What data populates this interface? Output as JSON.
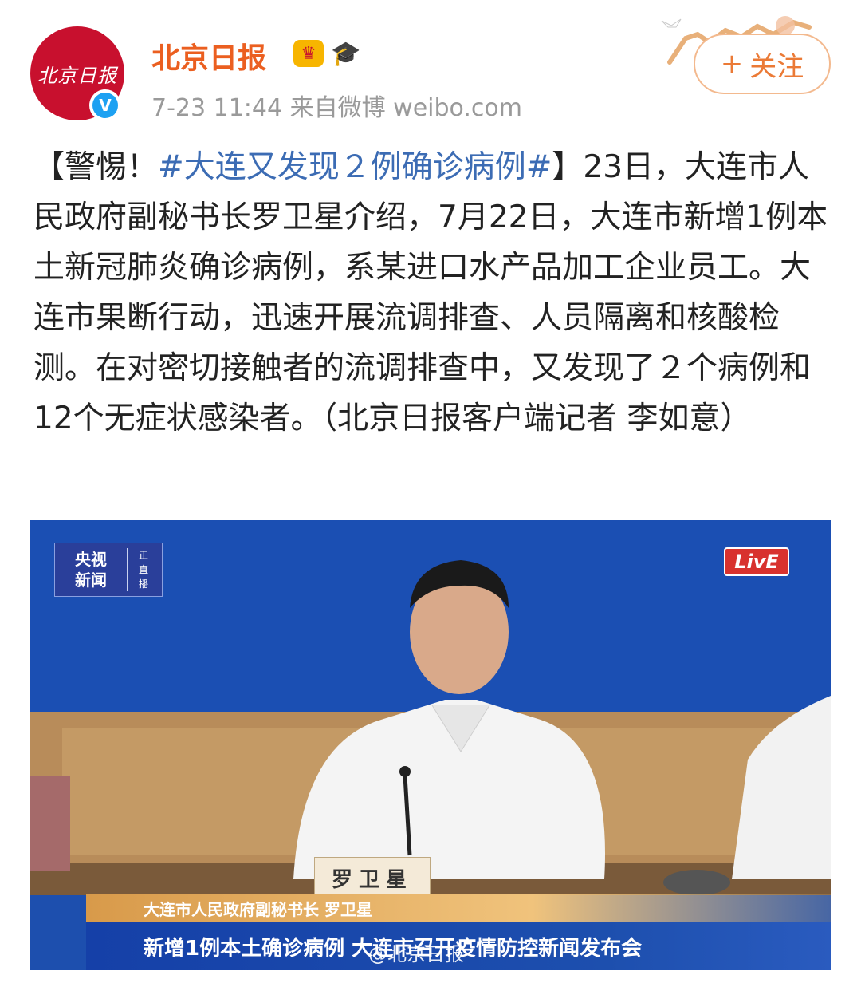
{
  "header": {
    "avatar_text": "北京日报",
    "verified_mark": "V",
    "username": "北京日报",
    "badges": [
      "crown-badge-icon",
      "graduation-cap-icon"
    ],
    "timestamp": "7-23 11:44",
    "source": "来自微博 weibo.com",
    "follow_label": "关注",
    "follow_plus": "+"
  },
  "post": {
    "prefix": "【警惕！",
    "hashtag": "#大连又发现２例确诊病例#",
    "body": "】23日，大连市人民政府副秘书长罗卫星介绍，7月22日，大连市新增1例本土新冠肺炎确诊病例，系某进口水产品加工企业员工。大连市果断行动，迅速开展流调排查、人员隔离和核酸检测。在对密切接触者的流调排查中，又发现了２个病例和12个无症状感染者。（北京日报客户端记者 李如意）"
  },
  "media": {
    "logo_main": "央视\n新闻",
    "logo_side": "正\n直\n播",
    "live": "LivE",
    "nameplate": "罗卫星",
    "caption_title": "大连市人民政府副秘书长  罗卫星",
    "caption_headline": "新增1例本土确诊病例  大连市召开疫情防控新闻发布会",
    "watermark": "@北京日报"
  },
  "colors": {
    "username": "#eb5f20",
    "hashtag": "#3c6cb4",
    "avatar_bg": "#c8102e",
    "follow": "#eb7a36",
    "verified": "#1da1f2"
  }
}
